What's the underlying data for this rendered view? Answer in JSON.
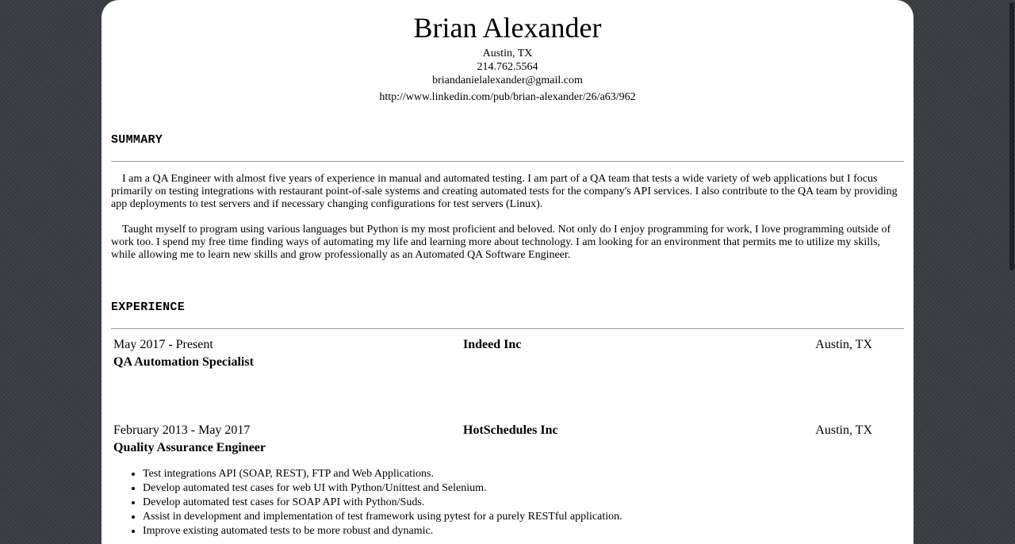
{
  "header": {
    "name": "Brian Alexander",
    "city": "Austin, TX",
    "phone": "214.762.5564",
    "email": "briandanielalexander@gmail.com",
    "linkedin": "http://www.linkedin.com/pub/brian-alexander/26/a63/962"
  },
  "summary": {
    "title": "SUMMARY",
    "paragraphs": [
      "I am a QA Engineer with almost five years of experience in manual and automated testing. I am part of a QA team that tests a wide variety of web applications but I focus primarily on testing integrations with restaurant point-of-sale systems and creating automated tests for the company's API services. I also contribute to the QA team by providing app deployments to test servers and if necessary changing configurations for test servers (Linux).",
      "Taught myself to program using various languages but Python is my most proficient and beloved. Not only do I enjoy programming for work, I love programming outside of work too. I spend my free time finding ways of automating my life and learning more about technology. I am looking for an environment that permits me to utilize my skills, while allowing me to learn new skills and grow professionally as an Automated QA Software Engineer."
    ]
  },
  "experience": {
    "title": "EXPERIENCE",
    "jobs": [
      {
        "dates": "May 2017 - Present",
        "company": "Indeed Inc",
        "location": "Austin, TX",
        "role": "QA Automation Specialist",
        "duties": []
      },
      {
        "dates": "February 2013 - May 2017",
        "company": "HotSchedules Inc",
        "location": "Austin, TX",
        "role": "Quality Assurance Engineer",
        "duties": [
          "Test integrations API (SOAP, REST), FTP and Web Applications.",
          "Develop automated test cases for web UI with Python/Unittest and Selenium.",
          "Develop automated test cases for SOAP API with Python/Suds.",
          "Assist in development and implementation of test framework using pytest for a purely RESTful application.",
          "Improve existing automated tests to be more robust and dynamic."
        ]
      }
    ]
  }
}
